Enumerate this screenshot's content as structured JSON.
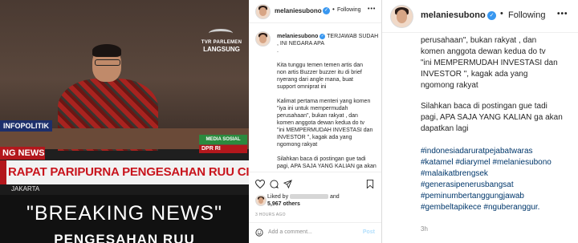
{
  "photo": {
    "tv_logo_top": "TVR PARLEMEN",
    "tv_logo_bottom": "LANGSUNG",
    "infopolitik": "INFOPOLITIK",
    "media_badge": "MEDIA SOSIAL",
    "dpr_badge": "DPR RI",
    "breaking_strip": "NG NEWS",
    "headline": "RAPAT PARIPURNA PENGESAHAN RUU CIPTA KERJA",
    "location": "JAKARTA",
    "caption": "\"BREAKING NEWS\"",
    "caption_cut": "PENGESAHAN RUU"
  },
  "panel": {
    "username": "melaniesubono",
    "follow": "Following",
    "more": "•••",
    "caption_lines": [
      "TERJAWAB SUDAH",
      ", INI NEGARA APA",
      ".",
      "Kita tunggu temen temen artis dan",
      "non artis Buzzer buzzer itu di brief",
      "nyerang dari angle mana, buat",
      "support omniprat ini",
      "",
      "Kalimat pertama menteri yang komen",
      "\"iya ini untuk mempermudah",
      "perusahaan\", bukan rakyat , dan",
      "komen anggota dewan kedua do tv",
      "\"ini MEMPERMUDAH INVESTASI dan",
      "INVESTOR \", kagak ada yang",
      "ngomong rakyat",
      "",
      "Silahkan baca di postingan gue tadi",
      "pagi, APA SAJA YANG KALIAN ga akan"
    ],
    "liked_by": "Liked by",
    "and": "and",
    "others": "5,967 others",
    "time": "3 HOURS AGO",
    "comment_placeholder": "Add a comment...",
    "post_label": "Post"
  },
  "right": {
    "username": "melaniesubono",
    "follow": "Following",
    "more": "•••",
    "lines": [
      "perusahaan\", bukan rakyat , dan",
      "komen anggota dewan kedua do tv",
      "\"ini MEMPERMUDAH INVESTASI dan",
      "INVESTOR \", kagak ada yang",
      "ngomong rakyat",
      "",
      "Silahkan baca di postingan gue tadi",
      "pagi, APA SAJA YANG KALIAN ga akan",
      "dapatkan lagi",
      ""
    ],
    "hashtags": [
      "#indonesiadaruratpejabatwaras",
      "#katamel #diarymel #melaniesubono",
      "#malaikatbrengsek",
      "#generasipenerusbangsat",
      "#peminumbertanggungjawab",
      "#gembeltapikece #nguberanggur."
    ],
    "time": "3h"
  },
  "colors": {
    "verified": "#3897f0",
    "hashtag": "#00376b",
    "headline_red": "#c8141c"
  }
}
